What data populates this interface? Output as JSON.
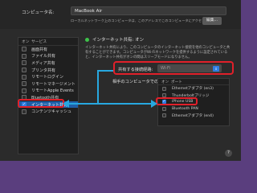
{
  "header": {
    "computer_name_label": "コンピュータ名:",
    "computer_name_value": "MacBook Air",
    "description": "ローカルネットワーク上のコンピュータは、このアドレスでこのコンピュータにアクセスできます:",
    "edit_label": "編集..."
  },
  "services": {
    "col_on": "オン",
    "col_service": "サービス",
    "items": [
      {
        "label": "画面共有",
        "checked": false
      },
      {
        "label": "ファイル共有",
        "checked": false
      },
      {
        "label": "メディア共有",
        "checked": false
      },
      {
        "label": "プリンタ共有",
        "checked": false
      },
      {
        "label": "リモートログイン",
        "checked": false
      },
      {
        "label": "リモートマネージメント",
        "checked": false
      },
      {
        "label": "リモートApple Events",
        "checked": false
      },
      {
        "label": "Bluetooth共有",
        "checked": false
      },
      {
        "label": "インターネット共有",
        "checked": true,
        "selected": true
      },
      {
        "label": "コンテンツキャッシュ",
        "checked": false
      }
    ]
  },
  "detail": {
    "status": "インターネット共有: オン",
    "description": "インターネット共有により、このコンピュータのインターネット接続を他のコンピュータと共有することができます。コンピュータがWi-Fiネットワークを提供するように設定されていると、インターネット共有がオンの間はスリープモードになりません。",
    "share_from_label": "共有する接続経路:",
    "share_from_value": "Wi-Fi",
    "ports_label": "相手のコンピュータでのポート:",
    "ports_col_on": "オン",
    "ports_col_port": "ポート",
    "ports": [
      {
        "label": "Ethernetアダプタ (en3)",
        "checked": false
      },
      {
        "label": "Thunderboltブリッジ",
        "checked": false
      },
      {
        "label": "iPhone USB",
        "checked": true
      },
      {
        "label": "Bluetooth PAN",
        "checked": false
      },
      {
        "label": "Ethernetアダプタ (en4)",
        "checked": false
      }
    ]
  },
  "colors": {
    "accent": "#2f7de1",
    "highlight": "#e0202a",
    "arrow": "#27a8e0",
    "status_on": "#3ec24a"
  },
  "footer": {
    "help_label": "?"
  }
}
